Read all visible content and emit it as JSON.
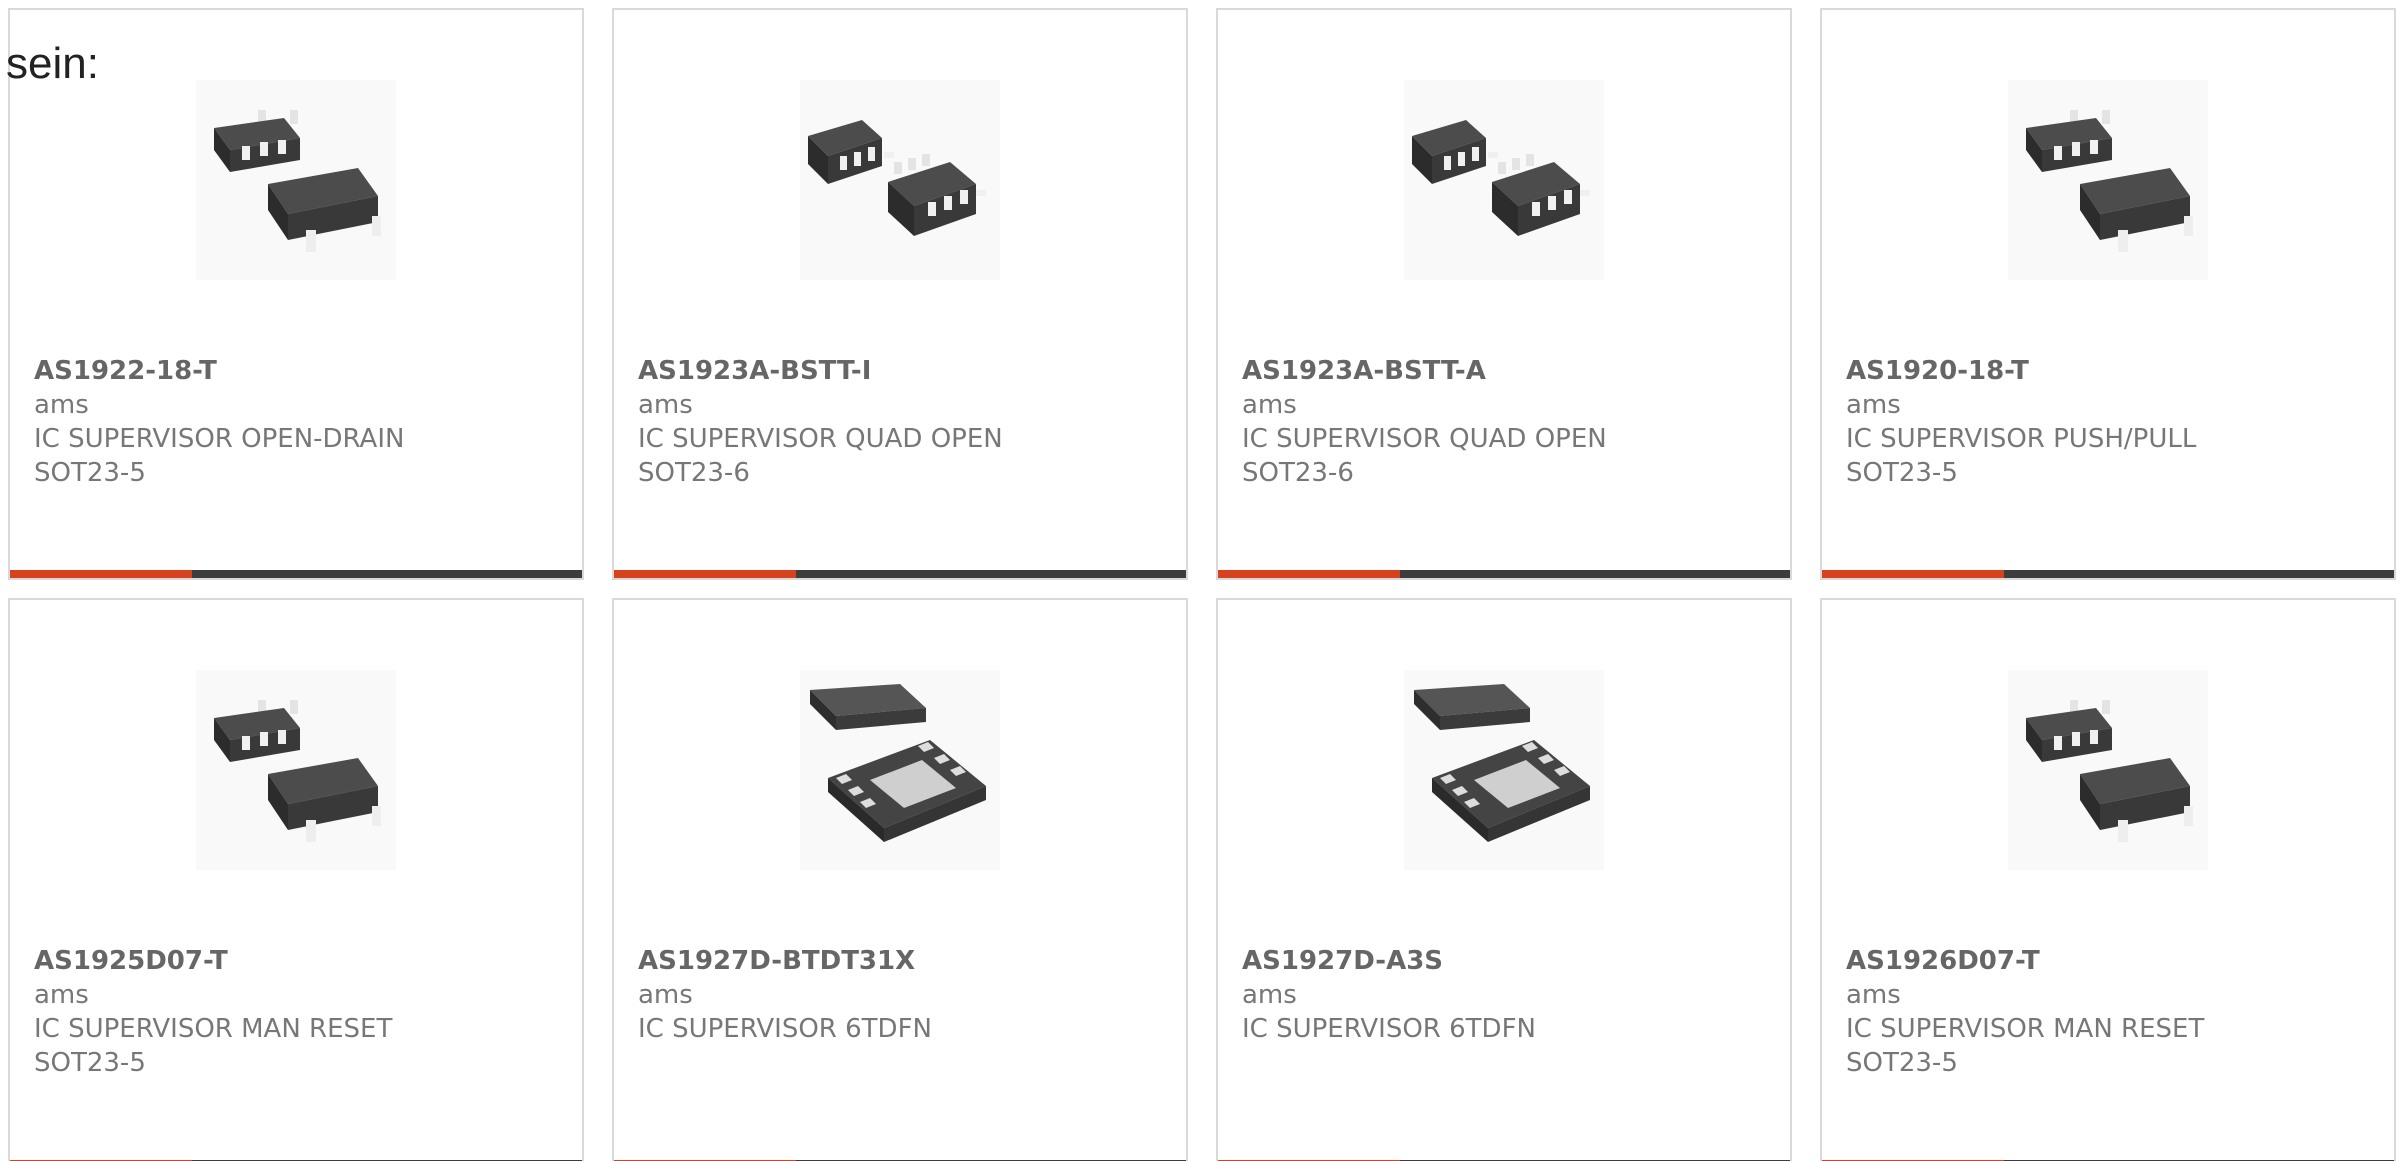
{
  "intro": "sein:",
  "colors": {
    "accent": "#d6411e",
    "bar": "#3d3d3d",
    "border": "#d9d9d9",
    "text": "#777777"
  },
  "products": [
    {
      "part": "AS1922-18-T",
      "maker": "ams",
      "desc": "IC SUPERVISOR OPEN-DRAIN",
      "package": "SOT23-5",
      "image_icon": "sot23-package-icon"
    },
    {
      "part": "AS1923A-BSTT-I",
      "maker": "ams",
      "desc": "IC SUPERVISOR QUAD OPEN",
      "package": "SOT23-6",
      "image_icon": "sot23-6-package-icon"
    },
    {
      "part": "AS1923A-BSTT-A",
      "maker": "ams",
      "desc": "IC SUPERVISOR QUAD OPEN",
      "package": "SOT23-6",
      "image_icon": "sot23-6-package-icon"
    },
    {
      "part": "AS1920-18-T",
      "maker": "ams",
      "desc": "IC SUPERVISOR PUSH/PULL",
      "package": "SOT23-5",
      "image_icon": "sot23-package-icon"
    },
    {
      "part": "AS1925D07-T",
      "maker": "ams",
      "desc": "IC SUPERVISOR MAN RESET",
      "package": "SOT23-5",
      "image_icon": "sot23-package-icon"
    },
    {
      "part": "AS1927D-BTDT31X",
      "maker": "ams",
      "desc": "IC SUPERVISOR 6TDFN",
      "package": "",
      "image_icon": "tdfn-package-icon"
    },
    {
      "part": "AS1927D-A3S",
      "maker": "ams",
      "desc": "IC SUPERVISOR 6TDFN",
      "package": "",
      "image_icon": "tdfn-package-icon"
    },
    {
      "part": "AS1926D07-T",
      "maker": "ams",
      "desc": "IC SUPERVISOR MAN RESET",
      "package": "SOT23-5",
      "image_icon": "sot23-package-icon"
    }
  ]
}
